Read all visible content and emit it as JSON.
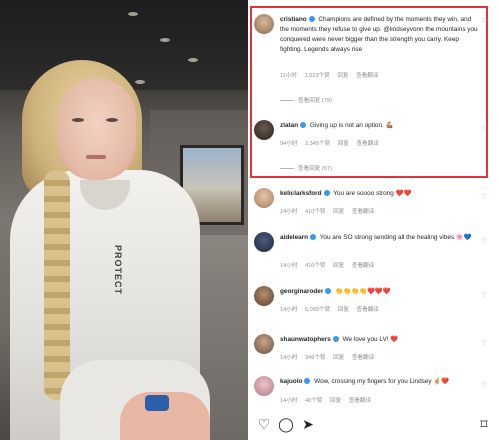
{
  "comments": [
    {
      "username": "cristiano",
      "text": "Champions are defined by the moments they win, and the moments they refuse to give up. @lindseyvonn the mountains you conquered were never bigger than the strength you carry. Keep fighting. Legends always rise",
      "time": "11小时",
      "likes": "1,023个赞",
      "reply": "回复",
      "more": "查看翻译",
      "replies": "查看回复 (79)"
    },
    {
      "username": "zlatan",
      "text": "Giving up is not an option. 💪🏽",
      "time": "94小时",
      "likes": "2,345个赞",
      "reply": "回复",
      "more": "查看翻译",
      "replies": "查看回复 (57)"
    },
    {
      "username": "keliclarksford",
      "text": "You are soooo strong ❤️❤️",
      "time": "14小时",
      "likes": "410个赞",
      "reply": "回复",
      "more": "查看翻译"
    },
    {
      "username": "aidelearn",
      "text": "You are SO strong sending all the healing vibes 🌸💙",
      "time": "14小时",
      "likes": "410个赞",
      "reply": "回复",
      "more": "查看翻译"
    },
    {
      "username": "georginaroder",
      "text": "👏👏👏👏❤️❤️❤️",
      "time": "14小时",
      "likes": "6,093个赞",
      "reply": "回复",
      "more": "查看翻译"
    },
    {
      "username": "shaunwatophers",
      "text": "We love you LV! ❤️",
      "time": "14小时",
      "likes": "349个赞",
      "reply": "回复",
      "more": "查看翻译"
    },
    {
      "username": "kajuolo",
      "text": "Wow, crossing my fingers for you Lindsey 🤞🏼❤️",
      "time": "14小时",
      "likes": "40个赞",
      "reply": "回复",
      "more": "查看翻译"
    }
  ],
  "hoodie_text": "PROTECT",
  "colors": {
    "highlight": "#e0343d",
    "verified": "#3897f0"
  },
  "icons": [
    "heart-icon",
    "comment-icon",
    "share-icon",
    "bookmark-icon"
  ]
}
